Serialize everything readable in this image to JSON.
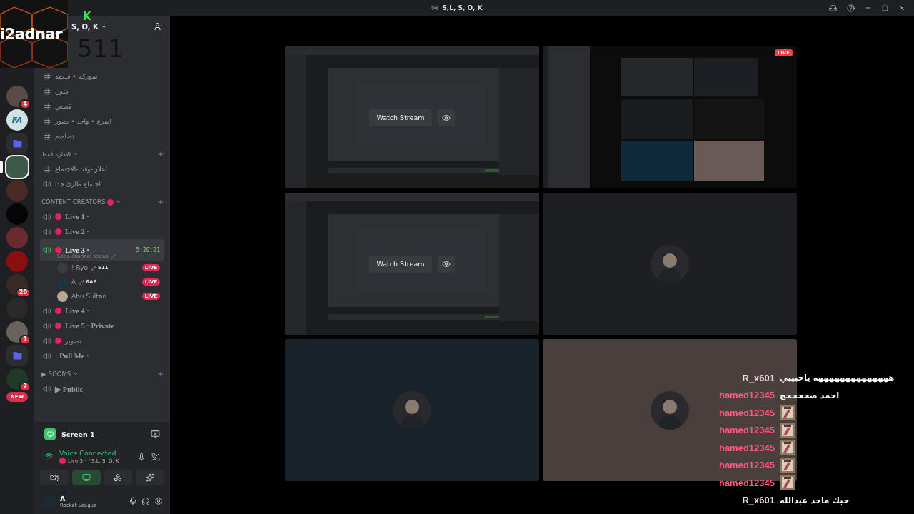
{
  "window": {
    "title": "S,L, S, O, K"
  },
  "webcam_overlay": {
    "name": "i2adnar",
    "counter": "511"
  },
  "server": {
    "name": "S, O, K",
    "logo": "K"
  },
  "server_rail": [
    {
      "kind": "avatar",
      "color": "#5a4a48",
      "badge": "4",
      "selected": false
    },
    {
      "kind": "logo",
      "label": "FA",
      "color": "#cfe3e6",
      "selected": false
    },
    {
      "kind": "folder",
      "color": "#5865f2",
      "selected": false
    },
    {
      "kind": "avatar",
      "color": "#3d5a48",
      "selected": true
    },
    {
      "kind": "avatar",
      "color": "#4a2a24",
      "selected": false
    },
    {
      "kind": "avatar",
      "color": "#050505",
      "selected": false
    },
    {
      "kind": "avatar",
      "color": "#6a2a30",
      "selected": false
    },
    {
      "kind": "avatar",
      "color": "#8a1010",
      "selected": false
    },
    {
      "kind": "avatar",
      "color": "#3a2a26",
      "badge": "20",
      "selected": false
    },
    {
      "kind": "avatar",
      "color": "#2a2a2a",
      "selected": false
    },
    {
      "kind": "avatar",
      "color": "#6a625c",
      "badge": "1",
      "selected": false
    },
    {
      "kind": "folder",
      "color": "#5865f2",
      "selected": false
    },
    {
      "kind": "avatar",
      "color": "#1f3a26",
      "badge": "2",
      "selected": false
    },
    {
      "kind": "new",
      "label": "NEW",
      "color": "#d8304a",
      "selected": false
    }
  ],
  "channel_groups": [
    {
      "channels": [
        {
          "kind": "text",
          "name": "سوركم • قديمه",
          "selected": false,
          "connected": false
        },
        {
          "kind": "text",
          "name": "قلون",
          "selected": false,
          "connected": false
        },
        {
          "kind": "text",
          "name": "قصص",
          "selected": false,
          "connected": false
        },
        {
          "kind": "text",
          "name": "اسرع • واحد • يصور",
          "selected": false,
          "connected": false
        },
        {
          "kind": "text",
          "name": "تصاميم",
          "selected": false,
          "connected": false
        }
      ]
    },
    {
      "category": "الادارة فقط",
      "channels": [
        {
          "kind": "text",
          "name": "اعلان-وقت-الاجتماع",
          "selected": false,
          "connected": false
        },
        {
          "kind": "voice",
          "name": "اجتماع طارئ جدا",
          "selected": false,
          "connected": false
        }
      ]
    },
    {
      "category": "CONTENT CREATORS",
      "live_dot": true,
      "channels": [
        {
          "kind": "voice",
          "live_dot": true,
          "blocked": false,
          "name": "Live 1 ·",
          "selected": false,
          "connected": false
        },
        {
          "kind": "voice",
          "live_dot": true,
          "blocked": false,
          "name": "Live 2 ·",
          "selected": false,
          "connected": false
        },
        {
          "kind": "voice",
          "live_dot": true,
          "blocked": false,
          "name": "Live 3 ·",
          "selected": true,
          "connected": true,
          "timer": "5:20:21",
          "status": "Set a channel status",
          "members": [
            {
              "name": "! Ryo",
              "tag": "511",
              "badge": "LIVE",
              "color": "#3a3a40"
            },
            {
              "name": "A",
              "tag": "6A6",
              "badge": "LIVE",
              "color": "#1c3444"
            },
            {
              "name": "Abu Sultan",
              "badge": "LIVE",
              "color": "#b8a898"
            }
          ]
        },
        {
          "kind": "voice",
          "live_dot": true,
          "blocked": false,
          "name": "Live 4 ·",
          "selected": false,
          "connected": false
        },
        {
          "kind": "voice",
          "live_dot": true,
          "blocked": false,
          "name": "Live 5 · Private",
          "selected": false,
          "connected": false
        },
        {
          "kind": "voice",
          "live_dot": false,
          "blocked": true,
          "name": "تصوير",
          "selected": false,
          "connected": false
        },
        {
          "kind": "voice",
          "live_dot": false,
          "blocked": false,
          "name": "· Pull Me ·",
          "selected": false,
          "connected": false
        }
      ]
    },
    {
      "category": "▶ ROOMS",
      "channels": [
        {
          "kind": "voice",
          "name": "▶ Public",
          "selected": false,
          "connected": false
        }
      ]
    }
  ],
  "panel": {
    "screen_share": "Screen 1",
    "status": "Voice Connected",
    "channel": "Live 3 ·",
    "server": "/ S,L, S, O, K",
    "controls": [
      {
        "kind": "camera-off",
        "active": false
      },
      {
        "kind": "screen",
        "active": true
      },
      {
        "kind": "activities",
        "active": false
      },
      {
        "kind": "soundboard",
        "active": false
      }
    ],
    "user": {
      "name": "A",
      "activity": "Rocket League"
    }
  },
  "tiles": [
    {
      "kind": "stream",
      "button": "Watch Stream"
    },
    {
      "kind": "preview",
      "badge": "LIVE"
    },
    {
      "kind": "stream",
      "button": "Watch Stream"
    },
    {
      "kind": "avatar",
      "color": "#1e1f22"
    },
    {
      "kind": "avatar",
      "color": "#17222b"
    },
    {
      "kind": "avatar",
      "color": "#4a3f3c"
    }
  ],
  "chat": [
    {
      "user": "R_x601",
      "color": "#f4d8e2",
      "kind": "text",
      "text": "ههههههههههههههه ياحبيبي"
    },
    {
      "user": "hamed12345",
      "color": "#ff5a80",
      "kind": "text",
      "text": "احمد صححححح"
    },
    {
      "user": "hamed12345",
      "color": "#ff5a80",
      "kind": "sticker"
    },
    {
      "user": "hamed12345",
      "color": "#ff5a80",
      "kind": "sticker"
    },
    {
      "user": "hamed12345",
      "color": "#ff5a80",
      "kind": "sticker"
    },
    {
      "user": "hamed12345",
      "color": "#ff5a80",
      "kind": "sticker"
    },
    {
      "user": "hamed12345",
      "color": "#ff5a80",
      "kind": "sticker"
    },
    {
      "user": "R_x601",
      "color": "#f4d8e2",
      "kind": "text",
      "text": "حبك ماجد عبدالله"
    }
  ]
}
